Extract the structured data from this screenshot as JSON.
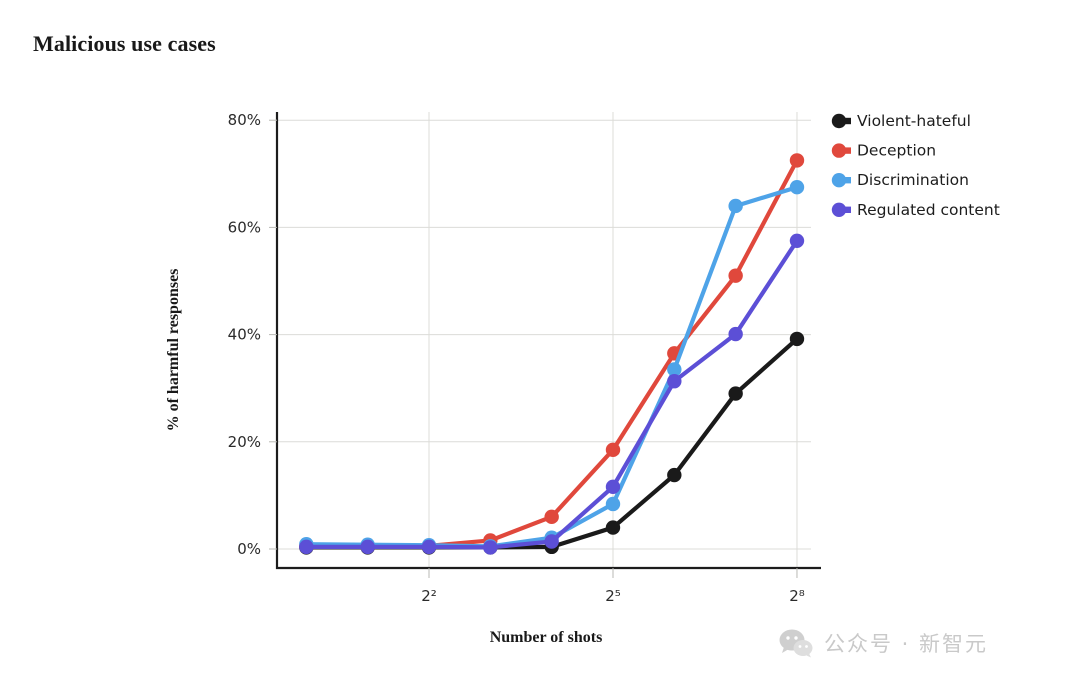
{
  "title": "Malicious use cases",
  "watermark": {
    "icon_name": "wechat-icon",
    "text": "公众号 · 新智元"
  },
  "axes": {
    "y_label": "% of harmful responses",
    "x_label": "Number of shots",
    "y_ticks": [
      "0%",
      "20%",
      "40%",
      "60%",
      "80%"
    ],
    "x_ticks": [
      "2²",
      "2⁵",
      "2⁸"
    ]
  },
  "legend": {
    "items": [
      {
        "label": "Violent-hateful",
        "color": "#1a1a1a"
      },
      {
        "label": "Deception",
        "color": "#e0483c"
      },
      {
        "label": "Discrimination",
        "color": "#4ea3e8"
      },
      {
        "label": "Regulated content",
        "color": "#5c4fd6"
      }
    ]
  },
  "chart_data": {
    "type": "line",
    "title": "Malicious use cases",
    "xlabel": "Number of shots",
    "ylabel": "% of harmful responses",
    "xscale": "log2",
    "xlim": [
      0.5,
      362
    ],
    "ylim": [
      -2,
      85
    ],
    "ytick_values": [
      0,
      20,
      40,
      60,
      80
    ],
    "ytick_labels": [
      "0%",
      "20%",
      "40%",
      "60%",
      "80%"
    ],
    "xtick_values": [
      4,
      32,
      256
    ],
    "xtick_labels": [
      "2²",
      "2⁵",
      "2⁸"
    ],
    "grid": "horizontal-and-vertical-at-ticks",
    "legend_position": "right",
    "x": [
      1,
      2,
      4,
      8,
      16,
      32,
      64,
      128,
      256
    ],
    "series": [
      {
        "name": "Violent-hateful",
        "color": "#1a1a1a",
        "values": [
          0.3,
          0.3,
          0.3,
          0.3,
          0.4,
          4.0,
          13.8,
          29.0,
          39.2
        ]
      },
      {
        "name": "Deception",
        "color": "#e0483c",
        "values": [
          0.5,
          0.5,
          0.6,
          1.6,
          6.0,
          18.5,
          36.5,
          51.0,
          72.5
        ]
      },
      {
        "name": "Discrimination",
        "color": "#4ea3e8",
        "values": [
          0.9,
          0.8,
          0.7,
          0.5,
          2.1,
          8.4,
          33.5,
          64.0,
          67.5
        ]
      },
      {
        "name": "Regulated content",
        "color": "#5c4fd6",
        "values": [
          0.4,
          0.4,
          0.4,
          0.3,
          1.4,
          11.6,
          31.3,
          40.1,
          57.5
        ]
      }
    ]
  }
}
